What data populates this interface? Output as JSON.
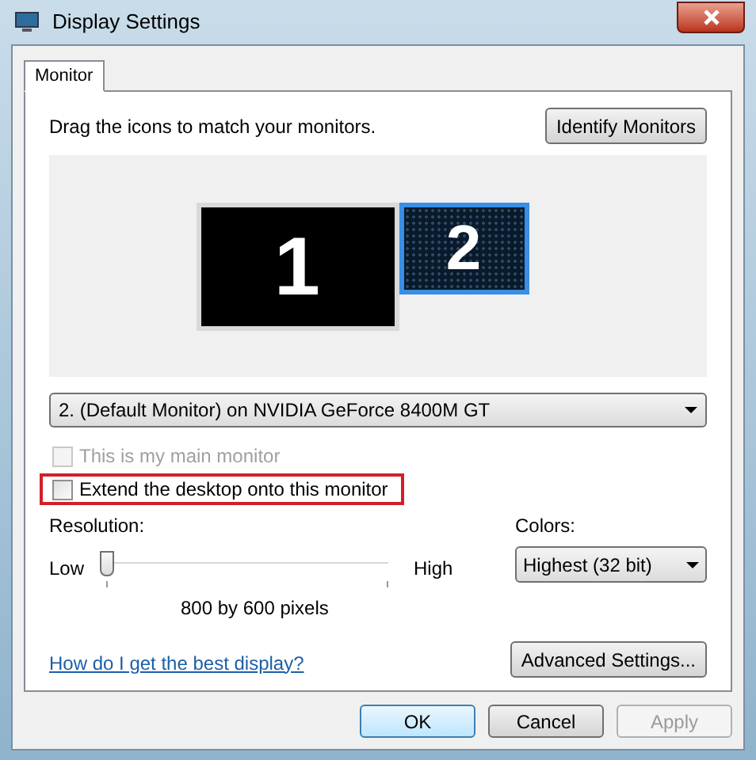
{
  "window": {
    "title": "Display Settings"
  },
  "tabs": [
    {
      "label": "Monitor",
      "selected": true
    }
  ],
  "instruction": "Drag the icons to match your monitors.",
  "identify_button": "Identify Monitors",
  "monitors": [
    {
      "label": "1",
      "selected": false
    },
    {
      "label": "2",
      "selected": true
    }
  ],
  "monitor_select": {
    "value": "2. (Default Monitor) on NVIDIA GeForce 8400M GT"
  },
  "checkboxes": [
    {
      "label": "This is my main monitor",
      "checked": false,
      "disabled": true,
      "highlighted": false
    },
    {
      "label": "Extend the desktop onto this monitor",
      "checked": false,
      "disabled": false,
      "highlighted": true
    }
  ],
  "resolution": {
    "label": "Resolution:",
    "low": "Low",
    "high": "High",
    "level": 0,
    "reading": "800 by 600 pixels"
  },
  "colors": {
    "label": "Colors:",
    "value": "Highest (32 bit)"
  },
  "help_link": "How do I get the best display?",
  "advanced_button": "Advanced Settings...",
  "buttons": [
    {
      "label": "OK",
      "kind": "default",
      "disabled": false
    },
    {
      "label": "Cancel",
      "kind": "normal",
      "disabled": false
    },
    {
      "label": "Apply",
      "kind": "normal",
      "disabled": true
    }
  ]
}
